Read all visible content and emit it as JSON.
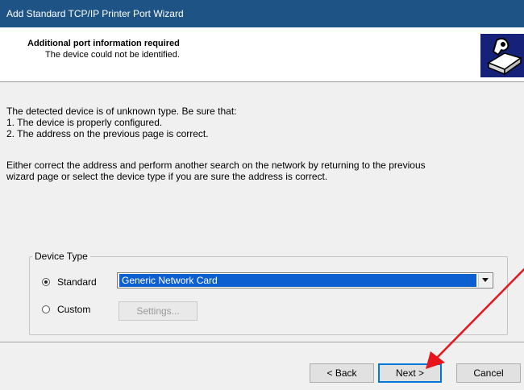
{
  "window": {
    "title": "Add Standard TCP/IP Printer Port Wizard"
  },
  "header": {
    "title": "Additional port information required",
    "subtitle": "The device could not be identified.",
    "icon": "printer-wizard-icon"
  },
  "body": {
    "message_lines": [
      "The detected device is of unknown type.  Be sure that:",
      "1. The device is properly configured.",
      "2.  The address on the previous page is correct."
    ],
    "instruction_lines": [
      "Either correct the address and perform another search on the network by returning to the previous",
      "wizard page or select the device type if you are sure the address is correct."
    ]
  },
  "device_type": {
    "legend": "Device Type",
    "standard_label": "Standard",
    "standard_selected": true,
    "standard_value": "Generic Network Card",
    "custom_label": "Custom",
    "custom_selected": false,
    "settings_label": "Settings..."
  },
  "footer": {
    "back_label": "< Back",
    "next_label": "Next >",
    "cancel_label": "Cancel"
  },
  "annotation": {
    "color": "#e8141b",
    "icon": "red-arrow-annotation"
  },
  "colors": {
    "titlebar": "#1e5385",
    "selection": "#0b5fd0",
    "default_button_border": "#0078d7"
  }
}
